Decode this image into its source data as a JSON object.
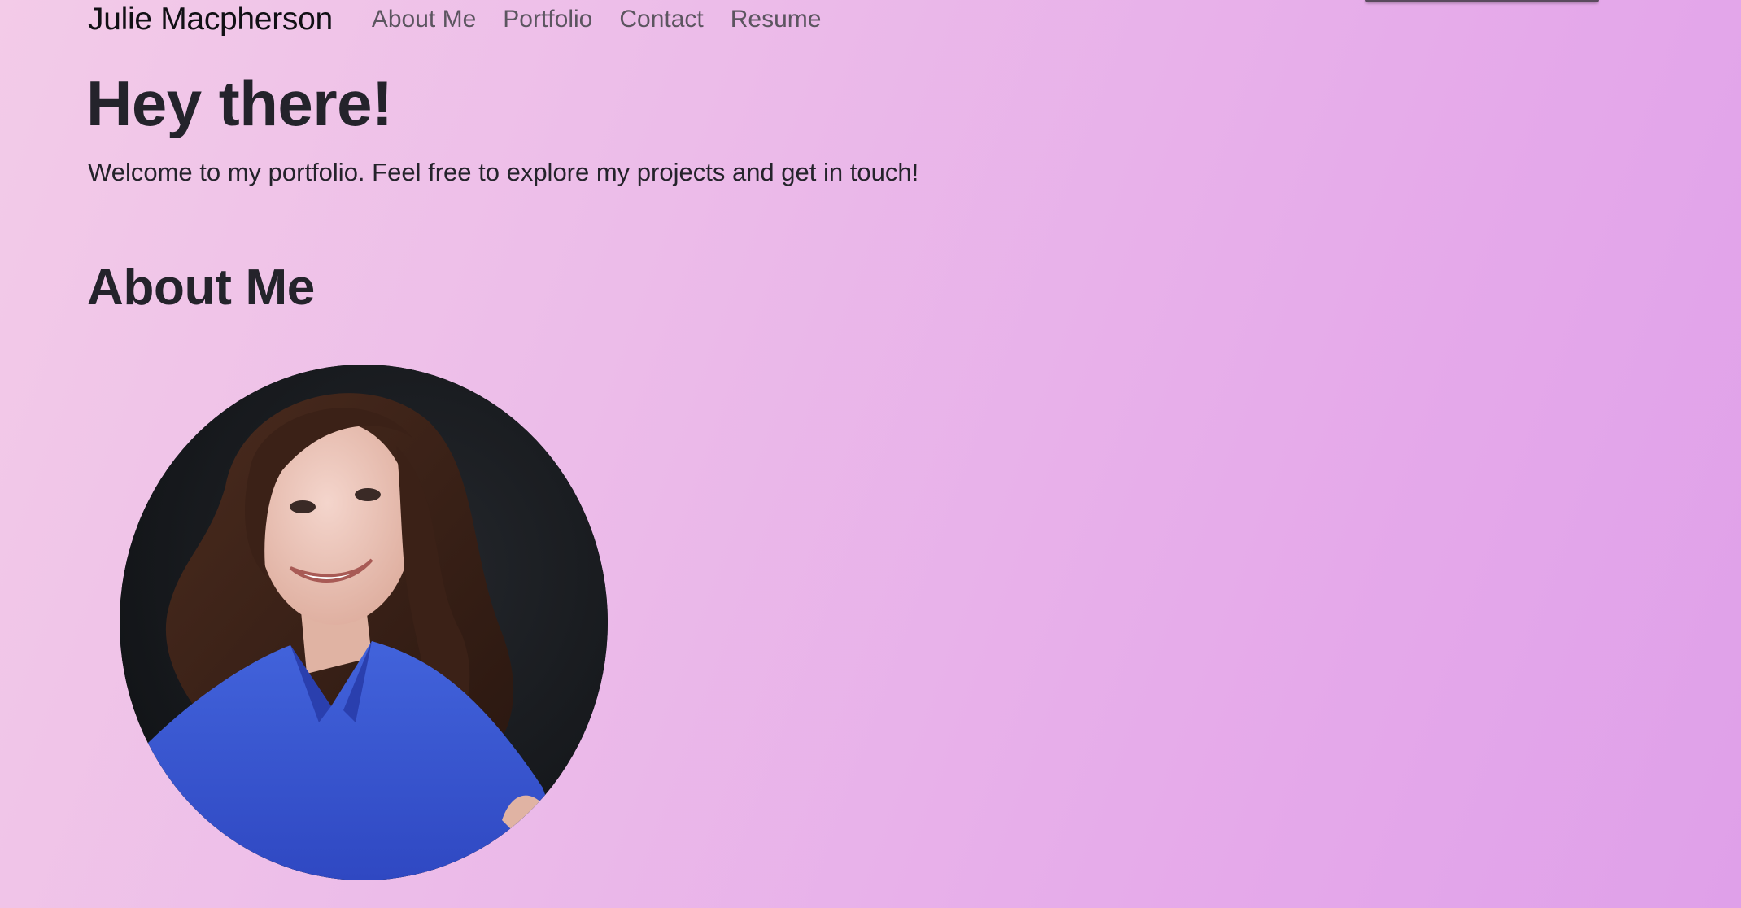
{
  "nav": {
    "brand": "Julie Macpherson",
    "links": [
      "About Me",
      "Portfolio",
      "Contact",
      "Resume"
    ]
  },
  "hero": {
    "title": "Hey there!",
    "text": "Welcome to my portfolio. Feel free to explore my projects and get in touch!"
  },
  "about": {
    "title": "About Me"
  },
  "colors": {
    "background_start": "#f3cbe8",
    "background_end": "#dfa0e9",
    "text": "#24232b",
    "nav_link": "#5c5560",
    "shirt": "#3a55cf"
  },
  "icons": {
    "avatar": "portrait-photo"
  }
}
